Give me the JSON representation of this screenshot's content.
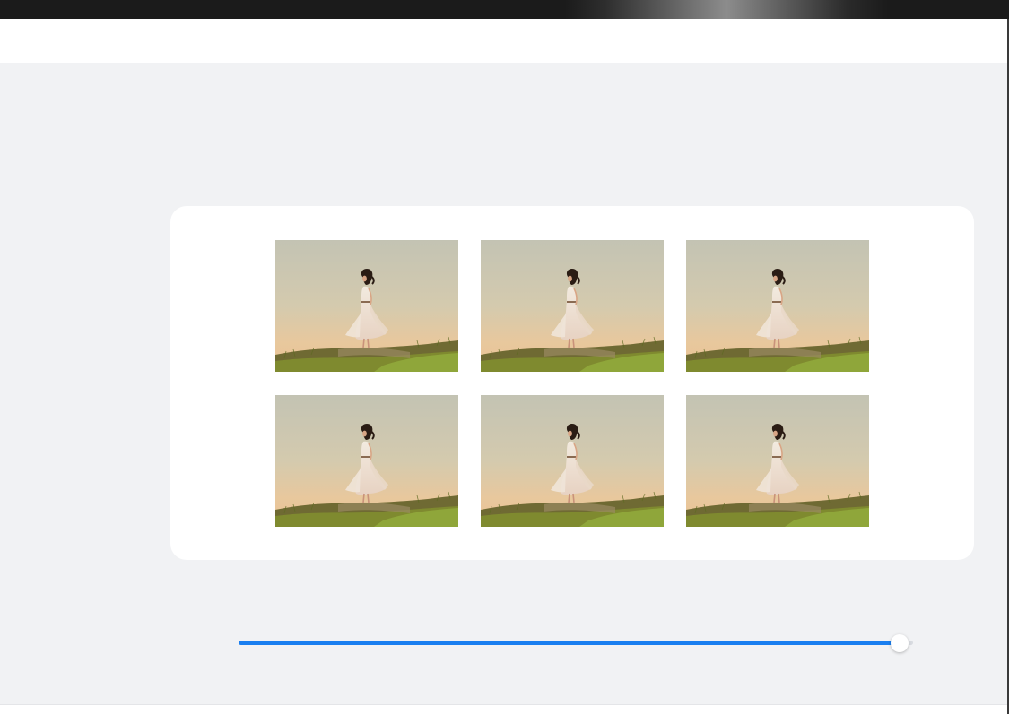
{
  "gallery": {
    "items": [
      {
        "icon": "woman-on-hill-photo"
      },
      {
        "icon": "woman-on-hill-photo"
      },
      {
        "icon": "woman-on-hill-photo"
      },
      {
        "icon": "woman-on-hill-photo"
      },
      {
        "icon": "woman-on-hill-photo"
      },
      {
        "icon": "woman-on-hill-photo"
      }
    ]
  },
  "slider": {
    "value": 0.98,
    "accent_color": "#1a7ff0"
  },
  "colors": {
    "workspace": "#f1f2f4",
    "card": "#ffffff",
    "topbar": "#1b1b1b"
  }
}
